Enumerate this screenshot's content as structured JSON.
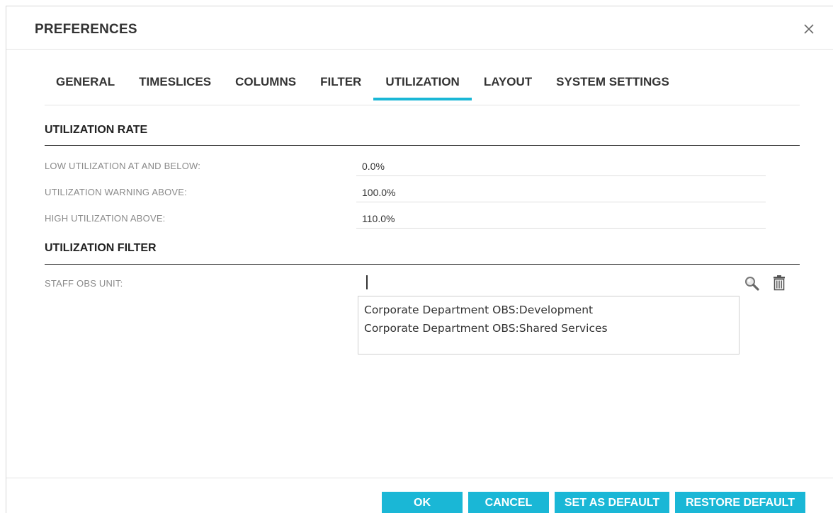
{
  "dialog": {
    "title": "PREFERENCES"
  },
  "tabs": [
    {
      "label": "GENERAL",
      "active": false
    },
    {
      "label": "TIMESLICES",
      "active": false
    },
    {
      "label": "COLUMNS",
      "active": false
    },
    {
      "label": "FILTER",
      "active": false
    },
    {
      "label": "UTILIZATION",
      "active": true
    },
    {
      "label": "LAYOUT",
      "active": false
    },
    {
      "label": "SYSTEM SETTINGS",
      "active": false
    }
  ],
  "utilization_rate": {
    "title": "UTILIZATION RATE",
    "fields": [
      {
        "label": "LOW UTILIZATION AT AND BELOW:",
        "value": "0.0%"
      },
      {
        "label": "UTILIZATION WARNING ABOVE:",
        "value": "100.0%"
      },
      {
        "label": "HIGH UTILIZATION ABOVE:",
        "value": "110.0%"
      }
    ]
  },
  "utilization_filter": {
    "title": "UTILIZATION FILTER",
    "staff_obs_label": "STAFF OBS UNIT:",
    "staff_obs_value": "",
    "suggestions": [
      "Corporate Department OBS:Development",
      "Corporate Department OBS:Shared Services"
    ]
  },
  "icons": {
    "close": "close-icon",
    "search": "search-icon",
    "delete": "trash-icon"
  },
  "colors": {
    "accent": "#1ab7d6"
  },
  "footer": {
    "ok_label": "OK",
    "cancel_label": "CANCEL",
    "set_default_label": "SET AS DEFAULT",
    "restore_default_label": "RESTORE DEFAULT"
  }
}
